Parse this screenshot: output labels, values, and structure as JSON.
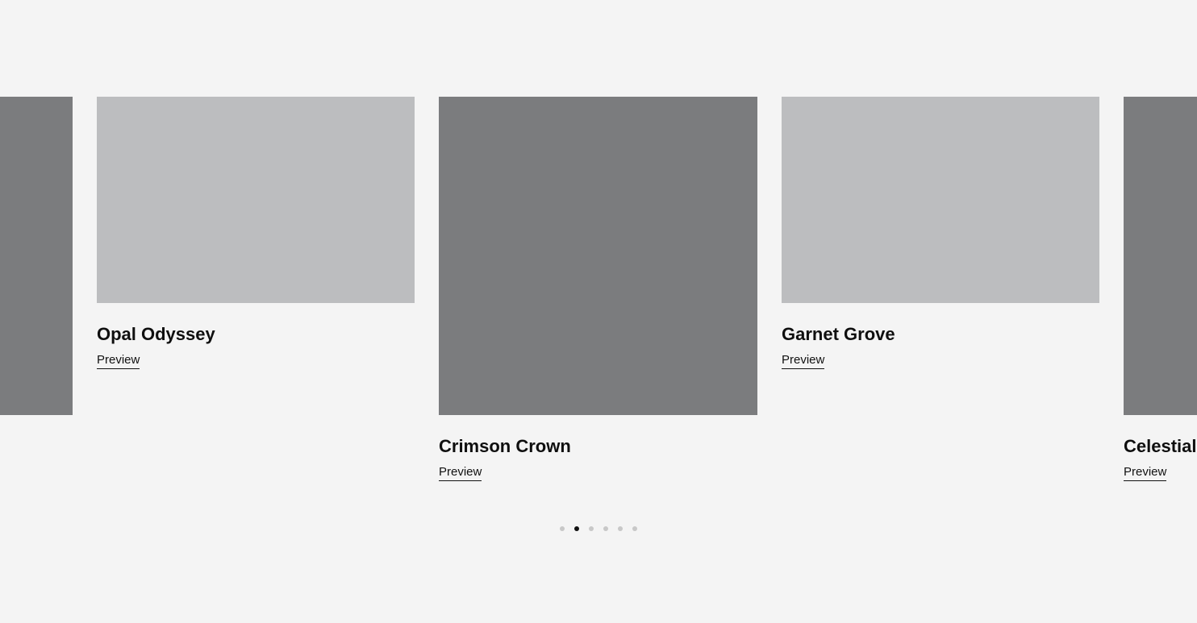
{
  "colors": {
    "background": "#f4f4f4",
    "image_dark": "#7b7c7e",
    "image_light": "#bcbdbf",
    "text": "#111111",
    "dot_inactive": "#c8c8c8",
    "dot_active": "#111111"
  },
  "carousel": {
    "cards": [
      {
        "title": "",
        "link_label": "",
        "image_shade": "dark"
      },
      {
        "title": "Opal Odyssey",
        "link_label": "Preview",
        "image_shade": "light"
      },
      {
        "title": "Crimson Crown",
        "link_label": "Preview",
        "image_shade": "dark"
      },
      {
        "title": "Garnet Grove",
        "link_label": "Preview",
        "image_shade": "light"
      },
      {
        "title": "Celestial",
        "link_label": "Preview",
        "image_shade": "dark"
      }
    ],
    "pagination": {
      "total": 6,
      "active_index": 1
    }
  }
}
